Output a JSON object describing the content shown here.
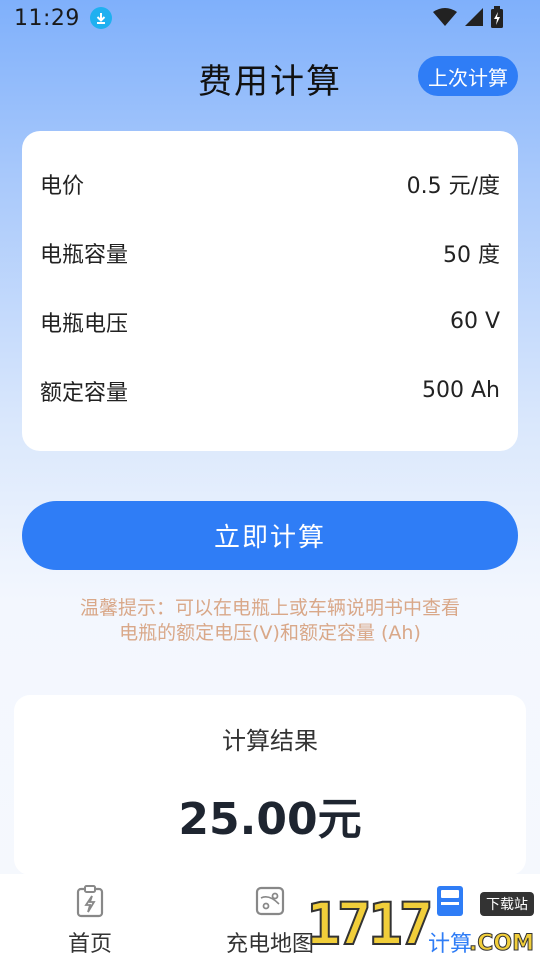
{
  "status": {
    "time": "11:29"
  },
  "header": {
    "title": "费用计算",
    "last_calc_label": "上次计算"
  },
  "params": [
    {
      "label": "电价",
      "value": "0.5 元/度"
    },
    {
      "label": "电瓶容量",
      "value": "50 度"
    },
    {
      "label": "电瓶电压",
      "value": "60 V"
    },
    {
      "label": "额定容量",
      "value": "500 Ah"
    }
  ],
  "calc_button": "立即计算",
  "tip": {
    "line1": "温馨提示：可以在电瓶上或车辆说明书中查看",
    "line2": "电瓶的额定电压(V)和额定容量 (Ah)"
  },
  "result": {
    "label": "计算结果",
    "value": "25.00元"
  },
  "tabs": [
    {
      "label": "首页",
      "icon": "clipboard-bolt-icon"
    },
    {
      "label": "充电地图",
      "icon": "map-icon"
    },
    {
      "label": "计算",
      "icon": "calculator-icon"
    }
  ],
  "watermark": {
    "number": "1717",
    "tag": "下载站",
    "suffix": ".COM"
  },
  "colors": {
    "accent": "#2f7df6",
    "tip": "#d9a889"
  }
}
